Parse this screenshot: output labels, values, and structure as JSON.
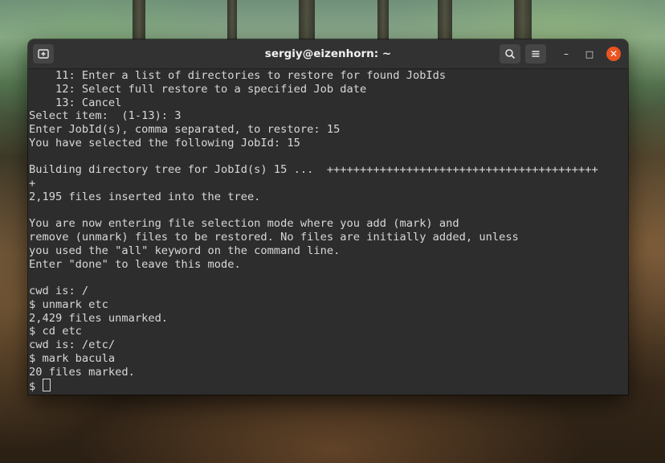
{
  "window": {
    "title": "sergiy@eizenhorn: ~",
    "new_tab_icon": "new-tab-icon",
    "search_icon": "search-icon",
    "menu_icon": "hamburger-menu-icon",
    "minimize_glyph": "–",
    "maximize_glyph": "□",
    "close_glyph": "✕",
    "close_color": "#e95420"
  },
  "terminal": {
    "background": "#2d2d2d",
    "foreground": "#d8d8d8",
    "lines": [
      "    11: Enter a list of directories to restore for found JobIds",
      "    12: Select full restore to a specified Job date",
      "    13: Cancel",
      "Select item:  (1-13): 3",
      "Enter JobId(s), comma separated, to restore: 15",
      "You have selected the following JobId: 15",
      "",
      "Building directory tree for JobId(s) 15 ...  +++++++++++++++++++++++++++++++++++++++++",
      "+",
      "2,195 files inserted into the tree.",
      "",
      "You are now entering file selection mode where you add (mark) and",
      "remove (unmark) files to be restored. No files are initially added, unless",
      "you used the \"all\" keyword on the command line.",
      "Enter \"done\" to leave this mode.",
      "",
      "cwd is: /",
      "$ unmark etc",
      "2,429 files unmarked.",
      "$ cd etc",
      "cwd is: /etc/",
      "$ mark bacula",
      "20 files marked."
    ],
    "prompt": "$ "
  }
}
